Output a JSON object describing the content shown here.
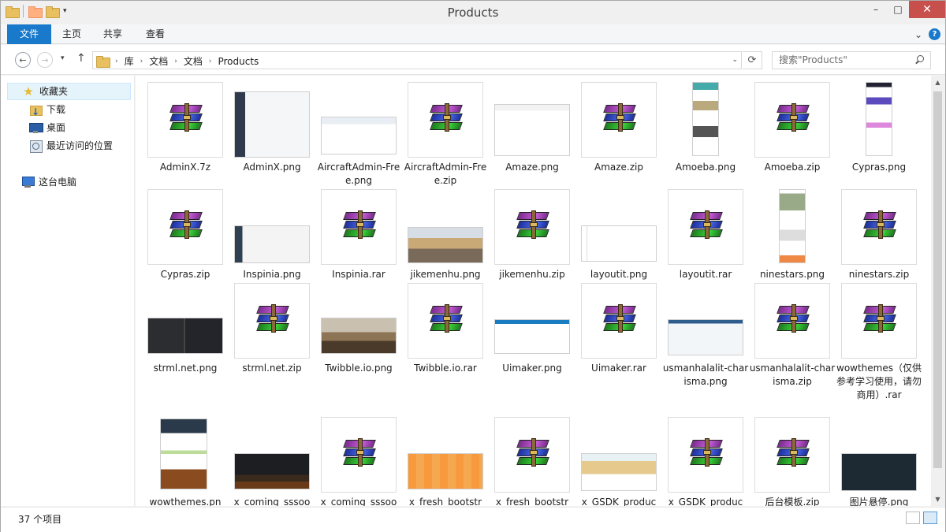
{
  "window": {
    "title": "Products",
    "minimize": "–",
    "maximize": "□",
    "close": "✕"
  },
  "ribbon": {
    "tabs": [
      "文件",
      "主页",
      "共享",
      "查看"
    ],
    "collapse": "⌄",
    "help": "?"
  },
  "nav": {
    "back": "←",
    "forward": "→",
    "recent_dd": "▾",
    "up": "↑",
    "breadcrumb": [
      "库",
      "文档",
      "文档",
      "Products"
    ],
    "sep": "›",
    "addr_dd": "⌄",
    "refresh": "⟳",
    "search_placeholder": "搜索\"Products\""
  },
  "sidebar": {
    "favorites": "收藏夹",
    "items": [
      "下载",
      "桌面",
      "最近访问的位置"
    ],
    "computer": "这台电脑"
  },
  "files": [
    {
      "name": "AdminX.7z",
      "type": "archive"
    },
    {
      "name": "AdminX.png",
      "type": "image",
      "theme": "adminx"
    },
    {
      "name": "AircraftAdmin-Free.png",
      "type": "image",
      "theme": "aircraft"
    },
    {
      "name": "AircraftAdmin-Free.zip",
      "type": "archive"
    },
    {
      "name": "Amaze.png",
      "type": "image",
      "theme": "amaze"
    },
    {
      "name": "Amaze.zip",
      "type": "archive"
    },
    {
      "name": "Amoeba.png",
      "type": "image",
      "theme": "amoeba"
    },
    {
      "name": "Amoeba.zip",
      "type": "archive"
    },
    {
      "name": "Cypras.png",
      "type": "image",
      "theme": "cypras"
    },
    {
      "name": "Cypras.zip",
      "type": "archive"
    },
    {
      "name": "Inspinia.png",
      "type": "image",
      "theme": "inspinia"
    },
    {
      "name": "Inspinia.rar",
      "type": "archive"
    },
    {
      "name": "jikemenhu.png",
      "type": "image",
      "theme": "road"
    },
    {
      "name": "jikemenhu.zip",
      "type": "archive"
    },
    {
      "name": "layoutit.png",
      "type": "image",
      "theme": "layoutit"
    },
    {
      "name": "layoutit.rar",
      "type": "archive"
    },
    {
      "name": "ninestars.png",
      "type": "image",
      "theme": "ninestars"
    },
    {
      "name": "ninestars.zip",
      "type": "archive"
    },
    {
      "name": "strml.net.png",
      "type": "image",
      "theme": "strml"
    },
    {
      "name": "strml.net.zip",
      "type": "archive"
    },
    {
      "name": "Twibble.io.png",
      "type": "image",
      "theme": "twibble"
    },
    {
      "name": "Twibble.io.rar",
      "type": "archive"
    },
    {
      "name": "Uimaker.png",
      "type": "image",
      "theme": "uimaker"
    },
    {
      "name": "Uimaker.rar",
      "type": "archive"
    },
    {
      "name": "usmanhalalit-charisma.png",
      "type": "image",
      "theme": "charisma"
    },
    {
      "name": "usmanhalalit-charisma.zip",
      "type": "archive"
    },
    {
      "name": "wowthemes（仅供参考学习使用，请勿商用）.rar",
      "type": "archive"
    },
    {
      "name": "wowthemes.pn",
      "type": "image",
      "theme": "wowthemes"
    },
    {
      "name": "x_coming_sssoo",
      "type": "image",
      "theme": "coming"
    },
    {
      "name": "x_coming_sssoo",
      "type": "archive"
    },
    {
      "name": "x_fresh_bootstr",
      "type": "image",
      "theme": "fresh"
    },
    {
      "name": "x_fresh_bootstr",
      "type": "archive"
    },
    {
      "name": "x_GSDK_produc",
      "type": "image",
      "theme": "gsdk"
    },
    {
      "name": "x_GSDK_produc",
      "type": "archive"
    },
    {
      "name": "后台模板.zip",
      "type": "archive"
    },
    {
      "name": "图片悬停.png",
      "type": "image",
      "theme": "hover"
    }
  ],
  "status": {
    "count": "37 个项目"
  },
  "scroll": {
    "up": "▲",
    "down": "▼"
  }
}
